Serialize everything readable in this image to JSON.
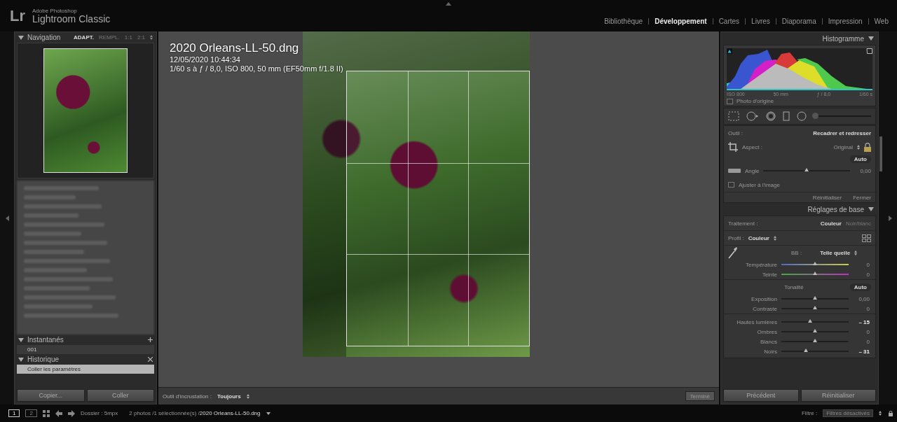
{
  "app": {
    "logo": "Lr",
    "brand_small": "Adobe Photoshop",
    "brand": "Lightroom Classic"
  },
  "modules": [
    {
      "label": "Bibliothèque",
      "selected": false
    },
    {
      "label": "Développement",
      "selected": true
    },
    {
      "label": "Cartes",
      "selected": false
    },
    {
      "label": "Livres",
      "selected": false
    },
    {
      "label": "Diaporama",
      "selected": false
    },
    {
      "label": "Impression",
      "selected": false
    },
    {
      "label": "Web",
      "selected": false
    }
  ],
  "left_panel": {
    "navigation": {
      "title": "Navigation",
      "zoom_options": [
        {
          "label": "ADAPT.",
          "selected": true
        },
        {
          "label": "REMPL.",
          "selected": false
        },
        {
          "label": "1:1",
          "selected": false
        },
        {
          "label": "2:1",
          "selected": false
        }
      ]
    },
    "snapshots": {
      "title": "Instantanés",
      "items": [
        {
          "label": "001"
        }
      ]
    },
    "history": {
      "title": "Historique",
      "items": [
        {
          "label": "Coller les paramètres",
          "selected": true
        }
      ]
    },
    "buttons": [
      "Copier...",
      "Coller"
    ]
  },
  "center": {
    "info": {
      "filename": "2020 Orleans-LL-50.dng",
      "datetime": "12/05/2020 10:44:34",
      "exposure": "1/60 s à ƒ / 8,0, ISO 800, 50 mm (EF50mm f/1.8 II)"
    },
    "toolbar": {
      "label": "Outil d'incrustation :",
      "value": "Toujours",
      "done": "Terminé"
    }
  },
  "right_panel": {
    "histogram": {
      "title": "Histogramme",
      "readings": [
        "ISO 800",
        "50 mm",
        "ƒ / 8,0",
        "1/60 s"
      ],
      "original_photo": {
        "label": "Photo d'origine",
        "checked": false
      }
    },
    "tools": {
      "size": {
        "level": 0.03
      }
    },
    "crop": {
      "tool_label": "Outil :",
      "tool_name": "Recadrer et redresser",
      "aspect_label": "Aspect :",
      "aspect_value": "Original",
      "locked": true,
      "auto": "Auto",
      "angle": {
        "label": "Angle",
        "level": 0.5,
        "reading": "0,00"
      },
      "fit": {
        "label": "Ajuster à l'image",
        "checked": false
      },
      "buttons": [
        "Réinitialiser",
        "Fermer"
      ]
    },
    "basic": {
      "title": "Réglages de base",
      "treatment_label": "Traitement :",
      "treatments": [
        {
          "label": "Couleur",
          "selected": true
        },
        {
          "label": "Noir/blanc",
          "selected": false
        }
      ],
      "profile_label": "Profil :",
      "profile_value": "Couleur",
      "wb_label": "BB :",
      "wb_value": "Telle quelle",
      "wb_sliders": [
        {
          "label": "Température",
          "kind": "temperature",
          "level": 0.5,
          "reading": "0",
          "modified": false
        },
        {
          "label": "Teinte",
          "kind": "tint",
          "level": 0.5,
          "reading": "0",
          "modified": false
        }
      ],
      "tone_label": "Tonalité",
      "auto": "Auto",
      "tone_sliders": [
        {
          "label": "Exposition",
          "kind": "plain",
          "level": 0.5,
          "reading": "0,00",
          "modified": false
        },
        {
          "label": "Contraste",
          "kind": "plain",
          "level": 0.5,
          "reading": "0",
          "modified": false
        }
      ],
      "presence_sliders": [
        {
          "label": "Hautes lumières",
          "kind": "plain",
          "level": 0.43,
          "reading": "– 15",
          "modified": true
        },
        {
          "label": "Ombres",
          "kind": "plain",
          "level": 0.5,
          "reading": "0",
          "modified": false
        },
        {
          "label": "Blancs",
          "kind": "plain",
          "level": 0.5,
          "reading": "0",
          "modified": false
        },
        {
          "label": "Noirs",
          "kind": "plain",
          "level": 0.36,
          "reading": "– 31",
          "modified": true
        }
      ]
    },
    "buttons": [
      "Précédent",
      "Réinitialiser"
    ]
  },
  "status_bar": {
    "views": [
      {
        "label": "1",
        "selected": true
      },
      {
        "label": "2",
        "selected": false
      }
    ],
    "folder": "Dossier : 5mpx",
    "selection": "2 photos /1 sélectionnée(s) /",
    "filename": "2020 Orleans-LL-50.dng",
    "filter_label": "Filtre :",
    "filter_value": "Filtres désactivés"
  }
}
